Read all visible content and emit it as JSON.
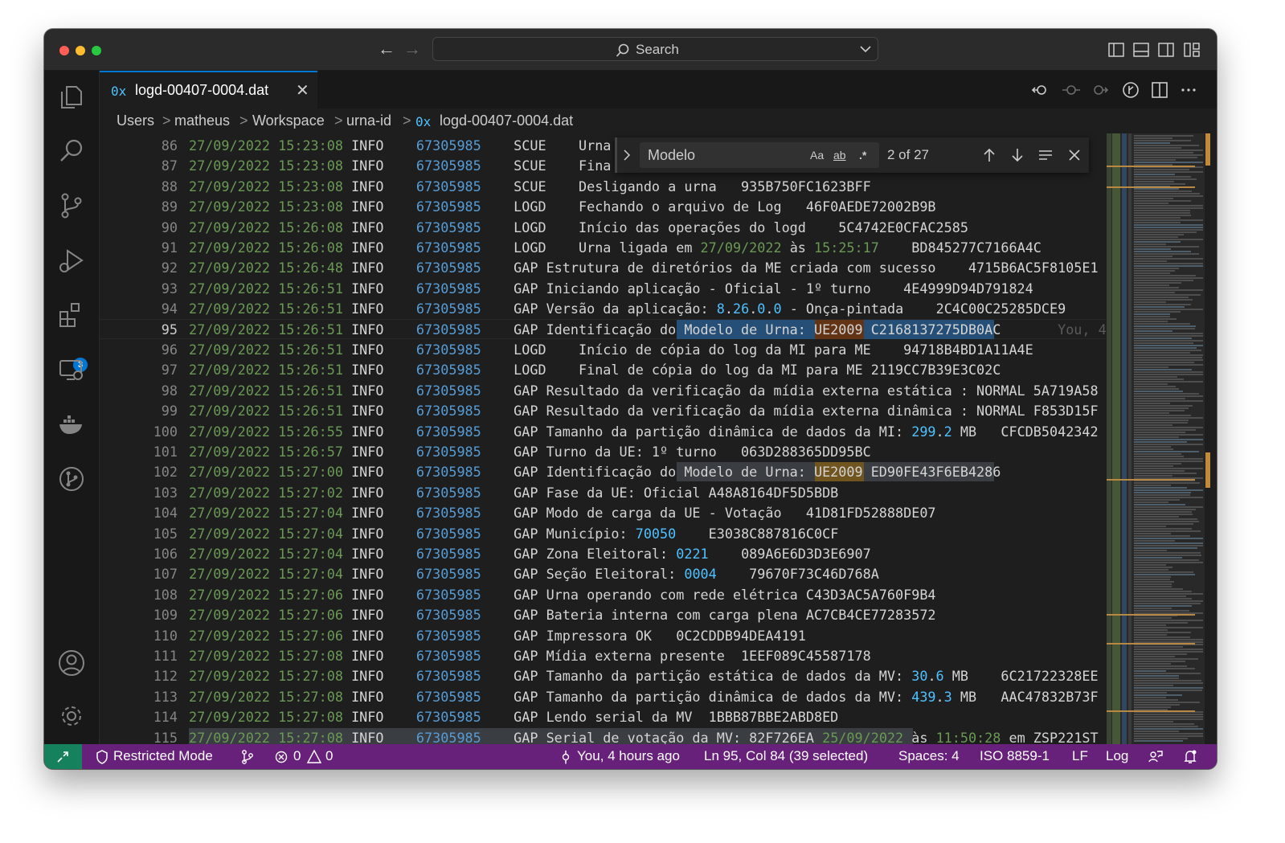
{
  "window": {
    "search_placeholder": "Search"
  },
  "colors": {
    "accent": "#0078d4",
    "status_bar": "#68217a",
    "remote": "#16825d"
  },
  "activity_bar": {
    "items": [
      "explorer-icon",
      "search-icon",
      "source-control-icon",
      "run-debug-icon",
      "extensions-icon",
      "remote-explorer-icon",
      "docker-icon",
      "gitlens-icon"
    ],
    "extensions_badge": "3",
    "bottom": [
      "accounts-icon",
      "settings-icon"
    ]
  },
  "tab": {
    "icon": "0x",
    "name": "logd-00407-0004.dat",
    "close": "✕"
  },
  "breadcrumb": {
    "items": [
      "Users",
      "matheus",
      "Workspace",
      "urna-id"
    ],
    "file_icon": "0x",
    "file": "logd-00407-0004.dat",
    "sep": ">"
  },
  "find": {
    "query": "Modelo",
    "opt_case": "Aa",
    "opt_word": "ab",
    "opt_regex": ".*",
    "count": "2 of 27"
  },
  "editor": {
    "current_line": 95,
    "blame_text": "You, 4",
    "lines": [
      {
        "n": 86,
        "dt": "27/09/2022 15:23:08",
        "lv": "INFO",
        "id": "67305985",
        "msg": "    SCUE    Urna"
      },
      {
        "n": 87,
        "dt": "27/09/2022 15:23:08",
        "lv": "INFO",
        "id": "67305985",
        "msg": "    SCUE    Fina"
      },
      {
        "n": 88,
        "dt": "27/09/2022 15:23:08",
        "lv": "INFO",
        "id": "67305985",
        "msg": "    SCUE    Desligando a urna   935B750FC1623BFF"
      },
      {
        "n": 89,
        "dt": "27/09/2022 15:23:08",
        "lv": "INFO",
        "id": "67305985",
        "msg": "    LOGD    Fechando o arquivo de Log   46F0AEDE72002B9B"
      },
      {
        "n": 90,
        "dt": "27/09/2022 15:26:08",
        "lv": "INFO",
        "id": "67305985",
        "msg": "    LOGD    Início das operações do logd    5C4742E0CFAC2585"
      },
      {
        "n": 91,
        "dt": "27/09/2022 15:26:08",
        "lv": "INFO",
        "id": "67305985",
        "msg": "    LOGD    Urna ligada em ",
        "d2": "27/09/2022",
        "mid": " às ",
        "t2": "15:25:17",
        "tail": "    BD845277C7166A4C"
      },
      {
        "n": 92,
        "dt": "27/09/2022 15:26:48",
        "lv": "INFO",
        "id": "67305985",
        "msg": "    GAP Estrutura de diretórios da ME criada com sucesso    4715B6AC5F8105E1"
      },
      {
        "n": 93,
        "dt": "27/09/2022 15:26:51",
        "lv": "INFO",
        "id": "67305985",
        "msg": "    GAP Iniciando aplicação - Oficial - 1º turno    4E4999D94D791824"
      },
      {
        "n": 94,
        "dt": "27/09/2022 15:26:51",
        "lv": "INFO",
        "id": "67305985",
        "msg": "    GAP Versão da aplicação: ",
        "v1": "8",
        "vd1": ".",
        "v2": "26",
        "vd2": ".",
        "v3": "0",
        "vd3": ".",
        "v4": "0",
        "tail": " - Onça-pintada    2C4C00C25285DCE9"
      },
      {
        "n": 95,
        "dt": "27/09/2022 15:26:51",
        "lv": "INFO",
        "id": "67305985",
        "msg": "    GAP Identificação do Modelo de Urna: UE2009 C2168137275DB0AC"
      },
      {
        "n": 96,
        "dt": "27/09/2022 15:26:51",
        "lv": "INFO",
        "id": "67305985",
        "msg": "    LOGD    Início de cópia do log da MI para ME    94718B4BD1A11A4E"
      },
      {
        "n": 97,
        "dt": "27/09/2022 15:26:51",
        "lv": "INFO",
        "id": "67305985",
        "msg": "    LOGD    Final de cópia do log da MI para ME 2119CC7B39E3C02C"
      },
      {
        "n": 98,
        "dt": "27/09/2022 15:26:51",
        "lv": "INFO",
        "id": "67305985",
        "msg": "    GAP Resultado da verificação da mídia externa estática : NORMAL 5A719A58"
      },
      {
        "n": 99,
        "dt": "27/09/2022 15:26:51",
        "lv": "INFO",
        "id": "67305985",
        "msg": "    GAP Resultado da verificação da mídia externa dinâmica : NORMAL F853D15F"
      },
      {
        "n": 100,
        "dt": "27/09/2022 15:26:55",
        "lv": "INFO",
        "id": "67305985",
        "msg": "    GAP Tamanho da partição dinâmica de dados da MI: ",
        "v1": "299",
        "vd1": ".",
        "v2": "2",
        "tail": " MB   CFCDB5042342"
      },
      {
        "n": 101,
        "dt": "27/09/2022 15:26:57",
        "lv": "INFO",
        "id": "67305985",
        "msg": "    GAP Turno da UE: 1º turno   063D288365DD95BC"
      },
      {
        "n": 102,
        "dt": "27/09/2022 15:27:00",
        "lv": "INFO",
        "id": "67305985",
        "msg": "    GAP Identificação do Modelo de Urna: UE2009 ED90FE43F6EB4286"
      },
      {
        "n": 103,
        "dt": "27/09/2022 15:27:02",
        "lv": "INFO",
        "id": "67305985",
        "msg": "    GAP Fase da UE: Oficial A48A8164DF5D5BDB"
      },
      {
        "n": 104,
        "dt": "27/09/2022 15:27:04",
        "lv": "INFO",
        "id": "67305985",
        "msg": "    GAP Modo de carga da UE - Votação   41D81FD52888DE07"
      },
      {
        "n": 105,
        "dt": "27/09/2022 15:27:04",
        "lv": "INFO",
        "id": "67305985",
        "msg": "    GAP Município: ",
        "v1": "70050",
        "tail": "    E3038C887816C0CF"
      },
      {
        "n": 106,
        "dt": "27/09/2022 15:27:04",
        "lv": "INFO",
        "id": "67305985",
        "msg": "    GAP Zona Eleitoral: ",
        "v1": "0221",
        "tail": "    089A6E6D3D3E6907"
      },
      {
        "n": 107,
        "dt": "27/09/2022 15:27:04",
        "lv": "INFO",
        "id": "67305985",
        "msg": "    GAP Seção Eleitoral: ",
        "v1": "0004",
        "tail": "    79670F73C46D768A"
      },
      {
        "n": 108,
        "dt": "27/09/2022 15:27:06",
        "lv": "INFO",
        "id": "67305985",
        "msg": "    GAP Urna operando com rede elétrica C43D3AC5A760F9B4"
      },
      {
        "n": 109,
        "dt": "27/09/2022 15:27:06",
        "lv": "INFO",
        "id": "67305985",
        "msg": "    GAP Bateria interna com carga plena AC7CB4CE77283572"
      },
      {
        "n": 110,
        "dt": "27/09/2022 15:27:06",
        "lv": "INFO",
        "id": "67305985",
        "msg": "    GAP Impressora OK   0C2CDDB94DEA4191"
      },
      {
        "n": 111,
        "dt": "27/09/2022 15:27:08",
        "lv": "INFO",
        "id": "67305985",
        "msg": "    GAP Mídia externa presente  1EEF089C45587178"
      },
      {
        "n": 112,
        "dt": "27/09/2022 15:27:08",
        "lv": "INFO",
        "id": "67305985",
        "msg": "    GAP Tamanho da partição estática de dados da MV: ",
        "v1": "30",
        "vd1": ".",
        "v2": "6",
        "tail": " MB    6C21722328EE"
      },
      {
        "n": 113,
        "dt": "27/09/2022 15:27:08",
        "lv": "INFO",
        "id": "67305985",
        "msg": "    GAP Tamanho da partição dinâmica de dados da MV: ",
        "v1": "439",
        "vd1": ".",
        "v2": "3",
        "tail": " MB   AAC47832B73F"
      },
      {
        "n": 114,
        "dt": "27/09/2022 15:27:08",
        "lv": "INFO",
        "id": "67305985",
        "msg": "    GAP Lendo serial da MV  1BBB87BBE2ABD8ED"
      },
      {
        "n": 115,
        "dt": "27/09/2022 15:27:08",
        "lv": "INFO",
        "id": "67305985",
        "msg": "    GAP Serial de votação da MV: 82F726EA ",
        "d2": "25/09/2022",
        "mid": " às ",
        "t2": "11:50:28",
        "tail": " em ZSP221ST"
      }
    ]
  },
  "status": {
    "restricted": "Restricted Mode",
    "errors": "0",
    "warnings": "0",
    "blame": "You, 4 hours ago",
    "position": "Ln 95, Col 84 (39 selected)",
    "spaces": "Spaces: 4",
    "encoding": "ISO 8859-1",
    "eol": "LF",
    "language": "Log"
  }
}
